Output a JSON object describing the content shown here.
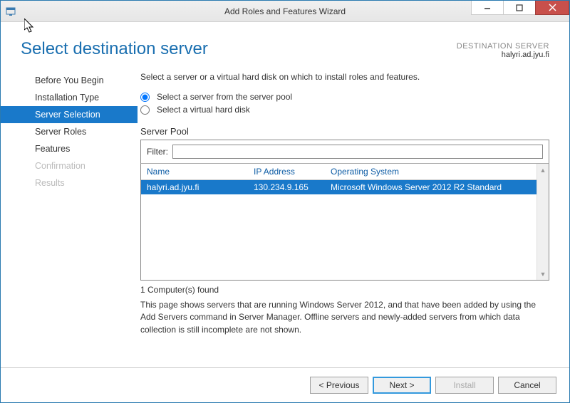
{
  "window": {
    "title": "Add Roles and Features Wizard"
  },
  "header": {
    "page_title": "Select destination server",
    "dest_label": "DESTINATION SERVER",
    "dest_server": "halyri.ad.jyu.fi"
  },
  "sidebar": {
    "items": [
      {
        "label": "Before You Begin",
        "state": "normal"
      },
      {
        "label": "Installation Type",
        "state": "normal"
      },
      {
        "label": "Server Selection",
        "state": "selected"
      },
      {
        "label": "Server Roles",
        "state": "normal"
      },
      {
        "label": "Features",
        "state": "normal"
      },
      {
        "label": "Confirmation",
        "state": "disabled"
      },
      {
        "label": "Results",
        "state": "disabled"
      }
    ]
  },
  "content": {
    "instruction": "Select a server or a virtual hard disk on which to install roles and features.",
    "radio_pool": "Select a server from the server pool",
    "radio_vhd": "Select a virtual hard disk",
    "pool_label": "Server Pool",
    "filter_label": "Filter:",
    "filter_value": "",
    "columns": {
      "name": "Name",
      "ip": "IP Address",
      "os": "Operating System"
    },
    "rows": [
      {
        "name": "halyri.ad.jyu.fi",
        "ip": "130.234.9.165",
        "os": "Microsoft Windows Server 2012 R2 Standard",
        "selected": true
      }
    ],
    "found_text": "1 Computer(s) found",
    "hint_text": "This page shows servers that are running Windows Server 2012, and that have been added by using the Add Servers command in Server Manager. Offline servers and newly-added servers from which data collection is still incomplete are not shown."
  },
  "footer": {
    "previous": "< Previous",
    "next": "Next >",
    "install": "Install",
    "cancel": "Cancel"
  }
}
